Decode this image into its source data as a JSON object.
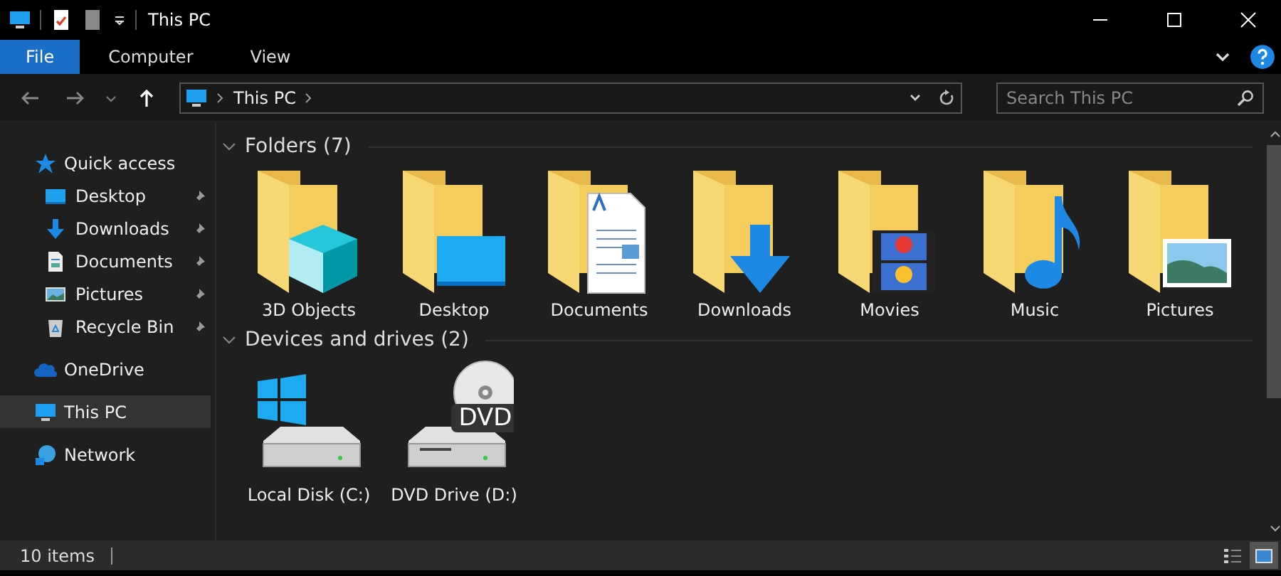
{
  "window": {
    "title": "This PC"
  },
  "ribbon": {
    "tabs": [
      {
        "label": "File",
        "selected": true
      },
      {
        "label": "Computer",
        "selected": false
      },
      {
        "label": "View",
        "selected": false
      }
    ]
  },
  "address": {
    "path": "This PC"
  },
  "search": {
    "placeholder": "Search This PC"
  },
  "sidebar": {
    "items": [
      {
        "label": "Quick access",
        "kind": "star",
        "pinned": false,
        "selected": false,
        "children": [
          {
            "label": "Desktop",
            "kind": "desktop",
            "pinned": true,
            "selected": false
          },
          {
            "label": "Downloads",
            "kind": "download",
            "pinned": true,
            "selected": false
          },
          {
            "label": "Documents",
            "kind": "document",
            "pinned": true,
            "selected": false
          },
          {
            "label": "Pictures",
            "kind": "picture",
            "pinned": true,
            "selected": false
          },
          {
            "label": "Recycle Bin",
            "kind": "recycle",
            "pinned": true,
            "selected": false
          }
        ]
      },
      {
        "label": "OneDrive",
        "kind": "cloud",
        "pinned": false,
        "selected": false
      },
      {
        "label": "This PC",
        "kind": "pc",
        "pinned": false,
        "selected": true
      },
      {
        "label": "Network",
        "kind": "network",
        "pinned": false,
        "selected": false
      }
    ]
  },
  "groups": [
    {
      "title": "Folders (7)",
      "expanded": true,
      "items": [
        {
          "label": "3D Objects",
          "kind": "cube"
        },
        {
          "label": "Desktop",
          "kind": "desktop"
        },
        {
          "label": "Documents",
          "kind": "document"
        },
        {
          "label": "Downloads",
          "kind": "download"
        },
        {
          "label": "Movies",
          "kind": "film"
        },
        {
          "label": "Music",
          "kind": "music"
        },
        {
          "label": "Pictures",
          "kind": "picture"
        }
      ]
    },
    {
      "title": "Devices and drives (2)",
      "expanded": true,
      "items": [
        {
          "label": "Local Disk (C:)",
          "kind": "windows-drive"
        },
        {
          "label": "DVD Drive (D:)",
          "kind": "dvd-drive",
          "badge": "DVD"
        }
      ]
    }
  ],
  "status_bar": {
    "text": "10 items"
  },
  "views": [
    {
      "kind": "details",
      "selected": false
    },
    {
      "kind": "tiles",
      "selected": true
    }
  ]
}
